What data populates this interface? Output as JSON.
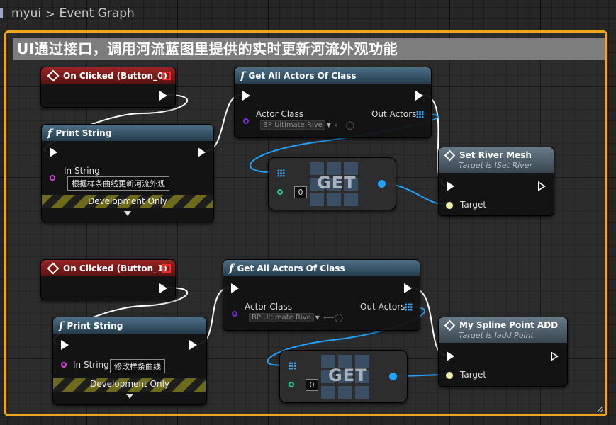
{
  "breadcrumb": {
    "root": "myui",
    "separator": ">",
    "current": "Event Graph"
  },
  "comment": {
    "title": "UI通过接口，调用河流蓝图里提供的实时更新河流外观功能"
  },
  "colors": {
    "comment_border": "#f0a51c",
    "event_header": "#8a1f1f",
    "function_header": "#3d5a6d",
    "array_wire": "#1fa3ff",
    "exec_wire": "#ffffff"
  },
  "groups": [
    {
      "event": {
        "title": "On Clicked (Button_0)"
      },
      "print": {
        "title": "Print String",
        "in_label": "In String",
        "in_value": "根据样条曲线更新河流外观",
        "dev": "Development Only"
      },
      "getall": {
        "title": "Get All Actors Of Class",
        "actor_class_label": "Actor Class",
        "class_value": "BP Ultimate Rive",
        "out_label": "Out Actors"
      },
      "get": {
        "label": "GET",
        "index": "0"
      },
      "message": {
        "title": "Set River Mesh",
        "subtitle": "Target is ISet River",
        "target_label": "Target"
      }
    },
    {
      "event": {
        "title": "On Clicked (Button_1)"
      },
      "print": {
        "title": "Print String",
        "in_label": "In String",
        "in_value": "修改样条曲线",
        "dev": "Development Only"
      },
      "getall": {
        "title": "Get All Actors Of Class",
        "actor_class_label": "Actor Class",
        "class_value": "BP Ultimate Rive",
        "out_label": "Out Actors"
      },
      "get": {
        "label": "GET",
        "index": "0"
      },
      "message": {
        "title": "My Spline Point ADD",
        "subtitle": "Target is Iadd Point",
        "target_label": "Target"
      }
    }
  ]
}
